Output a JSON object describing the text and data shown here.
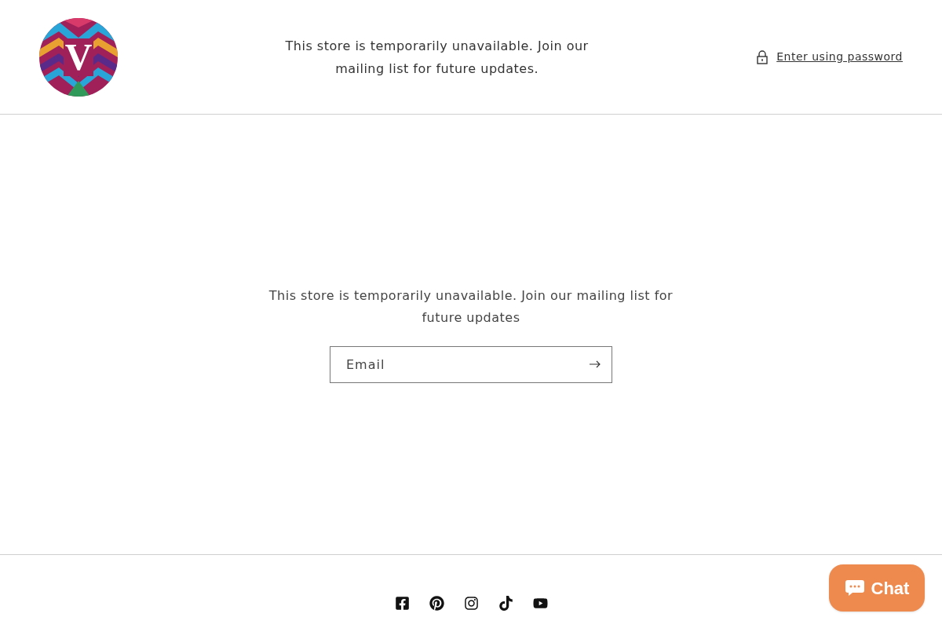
{
  "header": {
    "logo_letter": "V",
    "message": "This store is temporarily unavailable. Join our mailing list for future updates.",
    "password_link": "Enter using password"
  },
  "main": {
    "message": "This store is temporarily unavailable. Join our mailing list for future updates",
    "email_field": {
      "placeholder": "Email"
    }
  },
  "footer": {
    "social": [
      {
        "kind": "facebook"
      },
      {
        "kind": "pinterest"
      },
      {
        "kind": "instagram"
      },
      {
        "kind": "tiktok"
      },
      {
        "kind": "youtube"
      }
    ]
  },
  "chat_button": {
    "label": "Chat"
  }
}
